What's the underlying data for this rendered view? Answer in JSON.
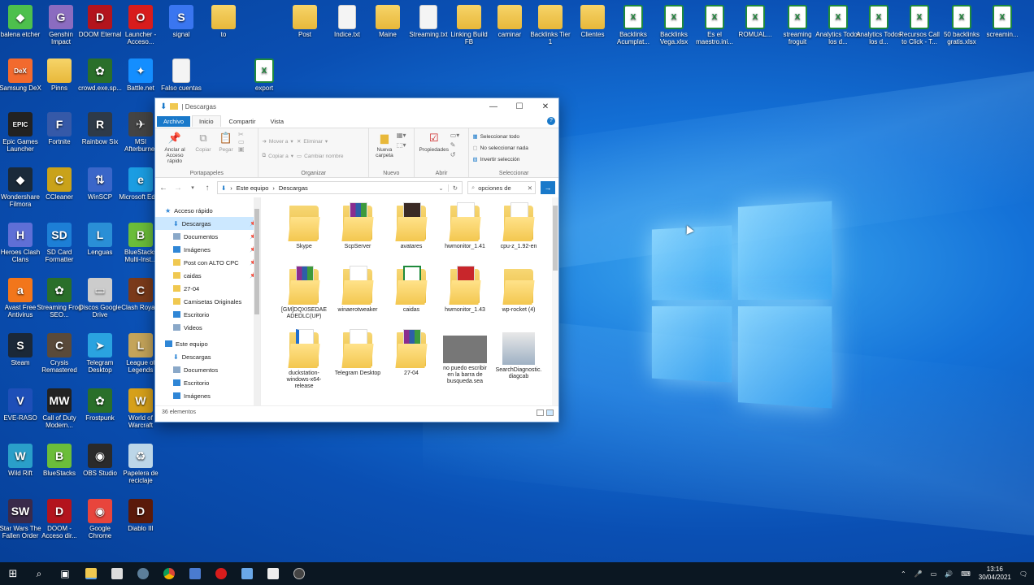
{
  "desktop": {
    "icons": [
      {
        "label": "balena etcher",
        "kind": "app",
        "color": "#4dc04d",
        "glyph": "◆"
      },
      {
        "label": "Genshin Impact",
        "kind": "app",
        "color": "#8b6cc0",
        "glyph": "G"
      },
      {
        "label": "DOOM Eternal",
        "kind": "app",
        "color": "#b3141d",
        "glyph": "D"
      },
      {
        "label": "Launcher - Acceso...",
        "kind": "app",
        "color": "#d81c1c",
        "glyph": "O"
      },
      {
        "label": "signal",
        "kind": "app",
        "color": "#3a76f0",
        "glyph": "S"
      },
      {
        "label": "to",
        "kind": "folder"
      },
      {
        "label": "Post",
        "kind": "folder"
      },
      {
        "label": "Indice.txt",
        "kind": "doc"
      },
      {
        "label": "Maine",
        "kind": "folder"
      },
      {
        "label": "Streaming.txt",
        "kind": "doc"
      },
      {
        "label": "Linking Build FB",
        "kind": "folder"
      },
      {
        "label": "caminar",
        "kind": "folder"
      },
      {
        "label": "Backlinks Tier 1",
        "kind": "folder"
      },
      {
        "label": "Clientes",
        "kind": "folder"
      },
      {
        "label": "Backlinks Acumplat...",
        "kind": "xls"
      },
      {
        "label": "Backlinks Vega.xlsx",
        "kind": "xls"
      },
      {
        "label": "Es el maestro.ini...",
        "kind": "xls"
      },
      {
        "label": "ROMUAL...",
        "kind": "xls"
      },
      {
        "label": "streaming froguit",
        "kind": "xls"
      },
      {
        "label": "Analytics Todos los d...",
        "kind": "xls"
      },
      {
        "label": "Analytics Todos los d...",
        "kind": "xls"
      },
      {
        "label": "Recursos Call to Click - T...",
        "kind": "xls"
      },
      {
        "label": "50 backlinks gratis.xlsx",
        "kind": "xls"
      },
      {
        "label": "screamin...",
        "kind": "xls"
      },
      {
        "label": "Samsung DeX",
        "kind": "app",
        "color": "#f26a2e",
        "glyph": "DeX"
      },
      {
        "label": "Pinns",
        "kind": "folder"
      },
      {
        "label": "crowd.exe.sp...",
        "kind": "app",
        "color": "#2a6f2a",
        "glyph": "✿"
      },
      {
        "label": "Battle.net",
        "kind": "app",
        "color": "#148eff",
        "glyph": "✦"
      },
      {
        "label": "Falso cuentas",
        "kind": "doc"
      },
      {
        "label": "export",
        "kind": "xls"
      },
      {
        "label": "Epic Games Launcher",
        "kind": "app",
        "color": "#222222",
        "glyph": "EPIC"
      },
      {
        "label": "Fortnite",
        "kind": "app",
        "color": "#3559a8",
        "glyph": "F"
      },
      {
        "label": "Rainbow Six",
        "kind": "app",
        "color": "#2e3a48",
        "glyph": "R"
      },
      {
        "label": "MSI Afterburner",
        "kind": "app",
        "color": "#444444",
        "glyph": "✈"
      },
      {
        "label": "Wondershare Filmora",
        "kind": "app",
        "color": "#1a2a3a",
        "glyph": "◆"
      },
      {
        "label": "CCleaner",
        "kind": "app",
        "color": "#c9a21a",
        "glyph": "C"
      },
      {
        "label": "WinSCP",
        "kind": "app",
        "color": "#3a66c9",
        "glyph": "⇅"
      },
      {
        "label": "Microsoft Edge",
        "kind": "app",
        "color": "#1b9de2",
        "glyph": "e"
      },
      {
        "label": "Heroes Clash Clans",
        "kind": "app",
        "color": "#5f6fd6",
        "glyph": "H"
      },
      {
        "label": "SD Card Formatter",
        "kind": "app",
        "color": "#1d7fd6",
        "glyph": "SD"
      },
      {
        "label": "Lenguas",
        "kind": "app",
        "color": "#2a8fd6",
        "glyph": "L"
      },
      {
        "label": "BlueStacks Multi-Inst...",
        "kind": "app",
        "color": "#6bbd3a",
        "glyph": "B"
      },
      {
        "label": "Avast Free Antivirus",
        "kind": "app",
        "color": "#f2761b",
        "glyph": "a"
      },
      {
        "label": "Streaming Frog SEO...",
        "kind": "app",
        "color": "#2a6f2a",
        "glyph": "✿"
      },
      {
        "label": "Discos Google Drive",
        "kind": "app",
        "color": "#cccccc",
        "glyph": "▭"
      },
      {
        "label": "Clash Royale",
        "kind": "app",
        "color": "#7a3a1a",
        "glyph": "C"
      },
      {
        "label": "Steam",
        "kind": "app",
        "color": "#1b2838",
        "glyph": "S"
      },
      {
        "label": "Crysis Remastered",
        "kind": "app",
        "color": "#5a4a3a",
        "glyph": "C"
      },
      {
        "label": "Telegram Desktop",
        "kind": "app",
        "color": "#2aa3e0",
        "glyph": "➤"
      },
      {
        "label": "League of Legends",
        "kind": "app",
        "color": "#c4a45a",
        "glyph": "L"
      },
      {
        "label": "EVE-RASO",
        "kind": "app",
        "color": "#1e4fb8",
        "glyph": "V"
      },
      {
        "label": "Call of Duty Modern...",
        "kind": "app",
        "color": "#222222",
        "glyph": "MW"
      },
      {
        "label": "Frostpunk",
        "kind": "app",
        "color": "#2a6f2a",
        "glyph": "✿"
      },
      {
        "label": "World of Warcraft",
        "kind": "app",
        "color": "#d6a01a",
        "glyph": "W"
      },
      {
        "label": "Wild Rift",
        "kind": "app",
        "color": "#2a9fc9",
        "glyph": "W"
      },
      {
        "label": "BlueStacks",
        "kind": "app",
        "color": "#6bbd3a",
        "glyph": "B"
      },
      {
        "label": "OBS Studio",
        "kind": "app",
        "color": "#2a2a2a",
        "glyph": "◉"
      },
      {
        "label": "Papelera de reciclaje",
        "kind": "app",
        "color": "#bcd6e8",
        "glyph": "♻"
      },
      {
        "label": "Star Wars The Fallen Order",
        "kind": "app",
        "color": "#3a2a4a",
        "glyph": "SW"
      },
      {
        "label": "DOOM - Acceso dir...",
        "kind": "app",
        "color": "#b3141d",
        "glyph": "D"
      },
      {
        "label": "Google Chrome",
        "kind": "app",
        "color": "#e8453c",
        "glyph": "◉"
      },
      {
        "label": "Diablo III",
        "kind": "app",
        "color": "#5a1a0a",
        "glyph": "D"
      }
    ]
  },
  "explorer": {
    "title": "Descargas",
    "tabs": [
      "Archivo",
      "Inicio",
      "Compartir",
      "Vista"
    ],
    "ribbon": {
      "clipboard": {
        "pin": "Anclar al Acceso rápido",
        "copy": "Copiar",
        "paste": "Pegar",
        "name": "Portapapeles"
      },
      "organize": {
        "move": "Mover a",
        "copyto": "Copiar a",
        "delete": "Eliminar",
        "rename": "Cambiar nombre",
        "name": "Organizar"
      },
      "new": {
        "folder": "Nueva carpeta",
        "name": "Nuevo"
      },
      "open": {
        "props": "Propiedades",
        "name": "Abrir"
      },
      "select": {
        "all": "Seleccionar todo",
        "none": "No seleccionar nada",
        "invert": "Invertir selección",
        "name": "Seleccionar"
      }
    },
    "address": {
      "root": "Este equipo",
      "current": "Descargas"
    },
    "search_value": "opciones de",
    "nav": [
      {
        "label": "Acceso rápido",
        "top": true,
        "icon": "star"
      },
      {
        "label": "Descargas",
        "sel": true,
        "pin": true,
        "icon": "down"
      },
      {
        "label": "Documentos",
        "pin": true,
        "icon": "doc"
      },
      {
        "label": "Imágenes",
        "pin": true,
        "icon": "img"
      },
      {
        "label": "Post con ALTO CPC",
        "pin": true,
        "icon": "fold"
      },
      {
        "label": "caidas",
        "pin": true,
        "icon": "fold"
      },
      {
        "label": "27-04",
        "icon": "fold"
      },
      {
        "label": "Camisetas Originales",
        "icon": "fold"
      },
      {
        "label": "Escritorio",
        "icon": "blue"
      },
      {
        "label": "Videos",
        "icon": "doc"
      },
      {
        "label": "Este equipo",
        "top": true,
        "icon": "pc"
      },
      {
        "label": "Descargas",
        "icon": "down"
      },
      {
        "label": "Documentos",
        "icon": "doc"
      },
      {
        "label": "Escritorio",
        "icon": "blue"
      },
      {
        "label": "Imágenes",
        "icon": "img"
      }
    ],
    "files": [
      {
        "name": "Skype",
        "type": "folder"
      },
      {
        "name": "ScpServer",
        "type": "winrar"
      },
      {
        "name": "avatares",
        "type": "avatar"
      },
      {
        "name": "hwmonitor_1.41",
        "type": "folder-paper"
      },
      {
        "name": "cpu-z_1.92-en",
        "type": "folder-paper"
      },
      {
        "name": "[GM]DQXISEDAEADEDLC(UP)",
        "type": "winrar"
      },
      {
        "name": "winaerotweaker",
        "type": "folder-paper"
      },
      {
        "name": "caidas",
        "type": "calc"
      },
      {
        "name": "hwmonitor_1.43",
        "type": "hw"
      },
      {
        "name": "wp-rocket (4)",
        "type": "folder"
      },
      {
        "name": "duckstation-windows-x64-release",
        "type": "duck"
      },
      {
        "name": "Telegram Desktop",
        "type": "tg"
      },
      {
        "name": "27-04",
        "type": "winrar"
      },
      {
        "name": "no puedo escribir en la barra de busqueda.sea",
        "type": "photo"
      },
      {
        "name": "SearchDiagnostic.diagcab",
        "type": "diag"
      }
    ],
    "status": "36 elementos"
  },
  "taskbar": {
    "clock_time": "13:16",
    "clock_date": "30/04/2021",
    "items": [
      "windows-start",
      "search",
      "task-view",
      "file-explorer",
      "store",
      "steam-app",
      "chrome",
      "screen-app",
      "opera",
      "app-1",
      "app-2",
      "obs"
    ]
  }
}
